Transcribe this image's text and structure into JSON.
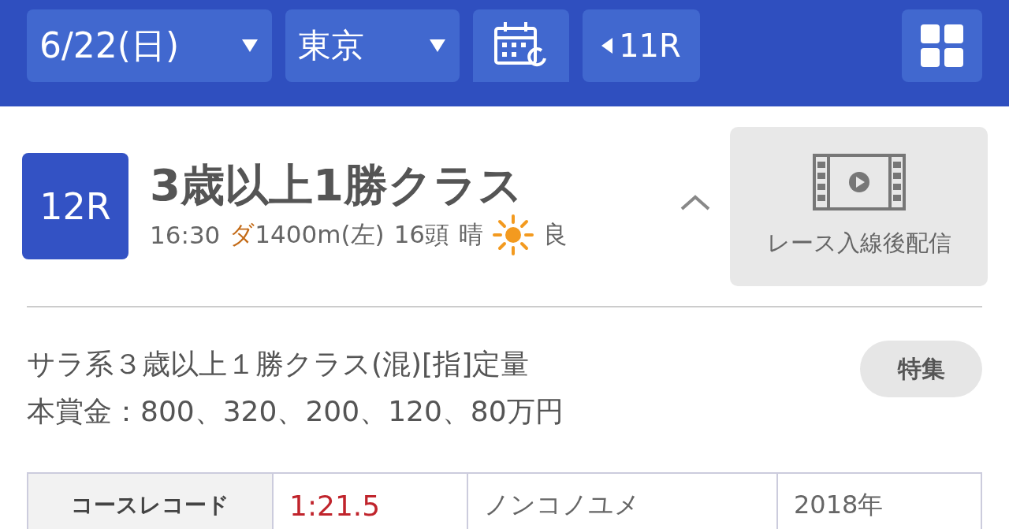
{
  "header": {
    "date": "6/22(日)",
    "venue": "東京",
    "prev_race": "11R"
  },
  "race": {
    "number": "12R",
    "title": "3歳以上1勝クラス",
    "time": "16:30",
    "surface": "ダ",
    "course": "1400m(左)",
    "runners": "16頭",
    "weather": "晴",
    "going": "良"
  },
  "video": {
    "label": "レース入線後配信"
  },
  "conditions": [
    "サラ系３歳以上１勝クラス(混)[指]定量",
    "本賞金：800、320、200、120、80万円"
  ],
  "feature_button": "特集",
  "record": {
    "label": "コースレコード",
    "time": "1:21.5",
    "horse": "ノンコノユメ",
    "year": "2018年"
  }
}
